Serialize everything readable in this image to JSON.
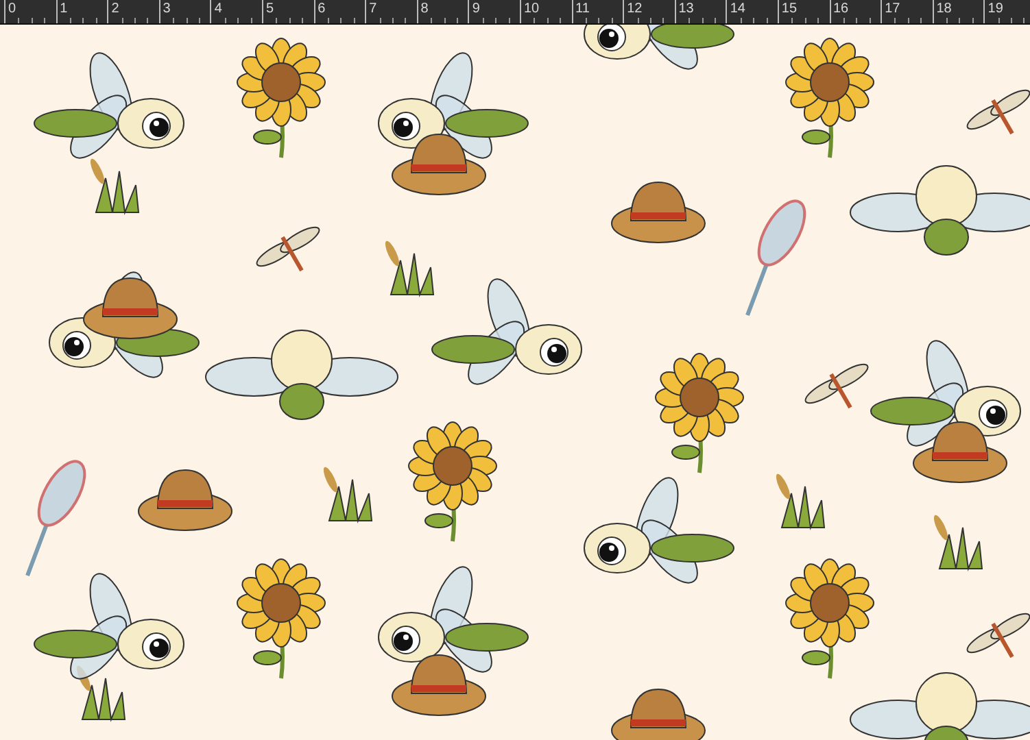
{
  "ruler": {
    "labels": [
      "0",
      "1",
      "2",
      "3",
      "4",
      "5",
      "6",
      "7",
      "8",
      "9",
      "10",
      "11",
      "12",
      "13",
      "14",
      "15",
      "16",
      "17",
      "18",
      "19"
    ]
  }
}
